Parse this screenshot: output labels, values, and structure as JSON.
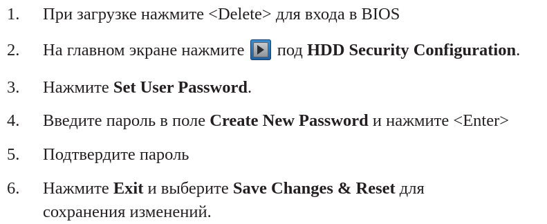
{
  "steps": [
    {
      "number": "1.",
      "segments": [
        {
          "text": "При загрузке нажмите <Delete> для входа в BIOS",
          "bold": false
        }
      ]
    },
    {
      "number": "2.",
      "segments": [
        {
          "text": "На главном экране нажмите",
          "bold": false
        },
        {
          "icon": "right-arrow-button-icon"
        },
        {
          "text": "под",
          "bold": false
        },
        {
          "text": "HDD Security Configuration",
          "bold": true
        },
        {
          "text": ".",
          "bold": false
        }
      ]
    },
    {
      "number": "3.",
      "segments": [
        {
          "text": "Нажмите",
          "bold": false
        },
        {
          "text": "Set User Password",
          "bold": true
        },
        {
          "text": ".",
          "bold": false
        }
      ]
    },
    {
      "number": "4.",
      "segments": [
        {
          "text": "Введите пароль в поле",
          "bold": false
        },
        {
          "text": "Create New Password",
          "bold": true
        },
        {
          "text": "и нажмите <Enter>",
          "bold": false
        }
      ]
    },
    {
      "number": "5.",
      "segments": [
        {
          "text": "Подтвердите пароль",
          "bold": false
        }
      ]
    },
    {
      "number": "6.",
      "segments": [
        {
          "text": "Нажмите",
          "bold": false
        },
        {
          "text": "Exit",
          "bold": true
        },
        {
          "text": "и выберите",
          "bold": false
        },
        {
          "text": "Save Changes & Reset",
          "bold": true
        },
        {
          "text": "для сохранения изменений.",
          "bold": false
        }
      ]
    }
  ],
  "icon_colors": {
    "button_blue": "#2a74b8",
    "arrow_dark": "#2b2f33"
  }
}
